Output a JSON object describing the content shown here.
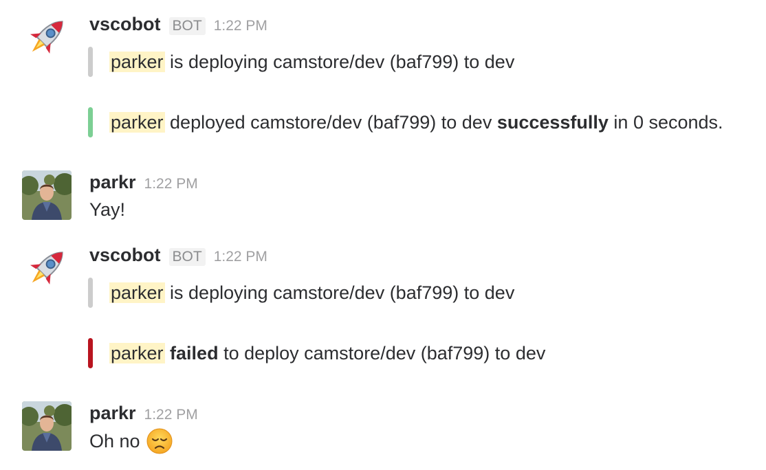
{
  "messages": [
    {
      "user": "vscobot",
      "badge": "BOT",
      "time": "1:22 PM",
      "attachments": [
        {
          "status": "pending",
          "mention": "parker",
          "pre": "",
          "bold": "",
          "post": " is deploying camstore/dev (baf799) to dev",
          "color": "#cccccc"
        },
        {
          "status": "success",
          "mention": "parker",
          "pre": " deployed camstore/dev (baf799) to dev ",
          "bold": "successfully",
          "post": " in 0 seconds.",
          "color": "#7ccf94"
        }
      ]
    },
    {
      "user": "parkr",
      "time": "1:22 PM",
      "text": "Yay!"
    },
    {
      "user": "vscobot",
      "badge": "BOT",
      "time": "1:22 PM",
      "attachments": [
        {
          "status": "pending",
          "mention": "parker",
          "pre": "",
          "bold": "",
          "post": " is deploying camstore/dev (baf799) to dev",
          "color": "#cccccc"
        },
        {
          "status": "failure",
          "mention": "parker",
          "pre": " ",
          "bold": "failed",
          "post": " to deploy camstore/dev (baf799) to dev",
          "color": "#b9141f"
        }
      ]
    },
    {
      "user": "parkr",
      "time": "1:22 PM",
      "text": "Oh no",
      "emoji": "disappointed-face-emoji"
    }
  ],
  "avatars": {
    "bot_icon": "rocket-icon",
    "user_icon": "user-photo-avatar"
  }
}
